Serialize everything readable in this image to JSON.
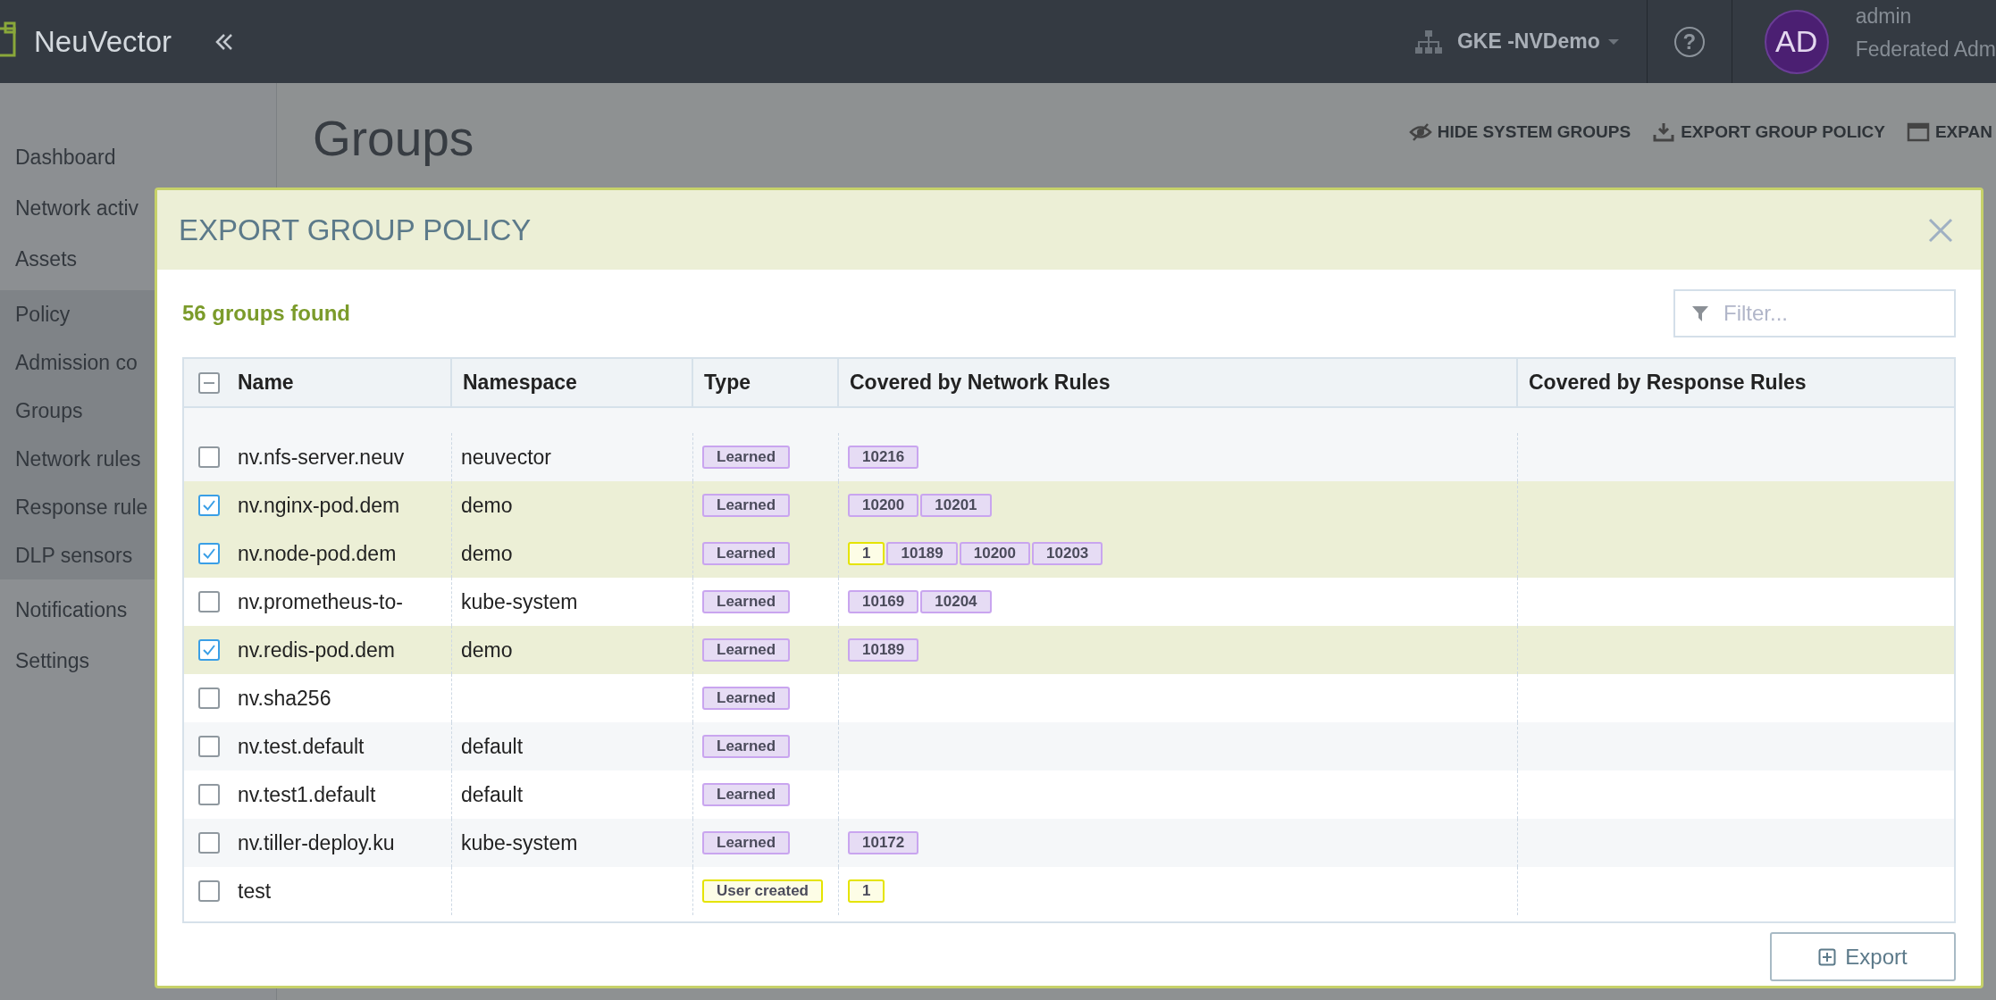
{
  "topbar": {
    "logo": "NeuVector",
    "cluster": "GKE -NVDemo",
    "help": "?",
    "avatar": "AD",
    "user": "admin",
    "role": "Federated Adm"
  },
  "sidebar": {
    "items": [
      {
        "label": "Dashboard",
        "kind": "plain"
      },
      {
        "label": "Network activ",
        "kind": "plain"
      },
      {
        "label": "Assets",
        "kind": "plain"
      },
      {
        "label": "Policy",
        "kind": "policy"
      },
      {
        "label": "Admission co",
        "kind": "policy"
      },
      {
        "label": "Groups",
        "kind": "policy"
      },
      {
        "label": "Network rules",
        "kind": "policy"
      },
      {
        "label": "Response rule",
        "kind": "policy"
      },
      {
        "label": "DLP sensors",
        "kind": "policy"
      },
      {
        "label": "Notifications",
        "kind": "plain"
      },
      {
        "label": "Settings",
        "kind": "plain"
      }
    ]
  },
  "page": {
    "title": "Groups",
    "actions": [
      {
        "label": "HIDE SYSTEM GROUPS"
      },
      {
        "label": "EXPORT GROUP POLICY"
      },
      {
        "label": "EXPAN"
      }
    ]
  },
  "modal": {
    "title": "EXPORT GROUP POLICY",
    "count": "56 groups found",
    "filter": {
      "placeholder": "Filter..."
    },
    "table": {
      "select_all_partial": true,
      "columns": [
        "Name",
        "Namespace",
        "Type",
        "Covered by Network Rules",
        "Covered by Response Rules"
      ],
      "rows": [
        {
          "name": "nv.nfs-server.neuv",
          "namespace": "neuvector",
          "type": {
            "label": "Learned",
            "kind": "learned"
          },
          "network_rules": [
            {
              "label": "10216",
              "kind": "learned"
            }
          ],
          "checked": false
        },
        {
          "name": "nv.nginx-pod.dem",
          "namespace": "demo",
          "type": {
            "label": "Learned",
            "kind": "learned"
          },
          "network_rules": [
            {
              "label": "10200",
              "kind": "learned"
            },
            {
              "label": "10201",
              "kind": "learned"
            }
          ],
          "checked": true
        },
        {
          "name": "nv.node-pod.dem",
          "namespace": "demo",
          "type": {
            "label": "Learned",
            "kind": "learned"
          },
          "network_rules": [
            {
              "label": "1",
              "kind": "user"
            },
            {
              "label": "10189",
              "kind": "learned"
            },
            {
              "label": "10200",
              "kind": "learned"
            },
            {
              "label": "10203",
              "kind": "learned"
            }
          ],
          "checked": true
        },
        {
          "name": "nv.prometheus-to-",
          "namespace": "kube-system",
          "type": {
            "label": "Learned",
            "kind": "learned"
          },
          "network_rules": [
            {
              "label": "10169",
              "kind": "learned"
            },
            {
              "label": "10204",
              "kind": "learned"
            }
          ],
          "checked": false
        },
        {
          "name": "nv.redis-pod.dem",
          "namespace": "demo",
          "type": {
            "label": "Learned",
            "kind": "learned"
          },
          "network_rules": [
            {
              "label": "10189",
              "kind": "learned"
            }
          ],
          "checked": true
        },
        {
          "name": "nv.sha256",
          "namespace": "",
          "type": {
            "label": "Learned",
            "kind": "learned"
          },
          "network_rules": [],
          "checked": false
        },
        {
          "name": "nv.test.default",
          "namespace": "default",
          "type": {
            "label": "Learned",
            "kind": "learned"
          },
          "network_rules": [],
          "checked": false
        },
        {
          "name": "nv.test1.default",
          "namespace": "default",
          "type": {
            "label": "Learned",
            "kind": "learned"
          },
          "network_rules": [],
          "checked": false
        },
        {
          "name": "nv.tiller-deploy.ku",
          "namespace": "kube-system",
          "type": {
            "label": "Learned",
            "kind": "learned"
          },
          "network_rules": [
            {
              "label": "10172",
              "kind": "learned"
            }
          ],
          "checked": false
        },
        {
          "name": "test",
          "namespace": "",
          "type": {
            "label": "User created",
            "kind": "user"
          },
          "network_rules": [
            {
              "label": "1",
              "kind": "user"
            }
          ],
          "checked": false
        }
      ]
    },
    "export_button": "Export"
  }
}
